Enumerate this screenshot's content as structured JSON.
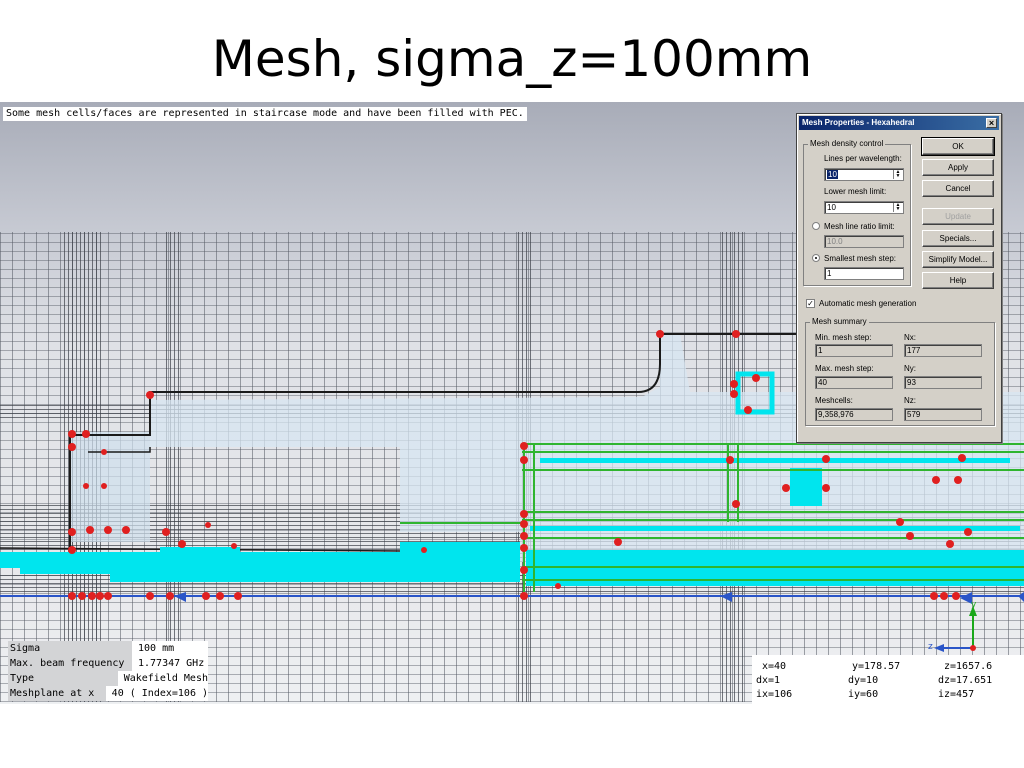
{
  "slide": {
    "title": "Mesh, sigma_z=100mm"
  },
  "viewport": {
    "status_message": "Some mesh cells/faces are represented in staircase mode and have been filled with PEC.",
    "axis_labels": {
      "y": "y",
      "z": "z"
    }
  },
  "legend": [
    {
      "key": "Sigma",
      "value": "100 mm"
    },
    {
      "key": "Max. beam frequency",
      "value": "1.77347 GHz"
    },
    {
      "key": "Type",
      "value": "Wakefield Mesh"
    },
    {
      "key": "Meshplane at x",
      "value": "40 ( Index=106 )"
    }
  ],
  "coordinates": {
    "x": "x=40",
    "y": "y=178.57",
    "z": "z=1657.6",
    "dx": "dx=1",
    "dy": "dy=10",
    "dz": "dz=17.651",
    "ix": "ix=106",
    "iy": "iy=60",
    "iz": "iz=457"
  },
  "dialog": {
    "title": "Mesh Properties - Hexahedral",
    "close_glyph": "×",
    "density_group": "Mesh density control",
    "lines_per_wavelength_label": "Lines per wavelength:",
    "lines_per_wavelength_value": "10",
    "lower_mesh_limit_label": "Lower mesh limit:",
    "lower_mesh_limit_value": "10",
    "ratio_limit_label": "Mesh line ratio limit:",
    "ratio_limit_value": "10.0",
    "smallest_step_label": "Smallest mesh step:",
    "smallest_step_value": "1",
    "auto_mesh_label": "Automatic mesh generation",
    "auto_mesh_checked": true,
    "selected_option": "smallest_mesh_step",
    "buttons": {
      "ok": "OK",
      "apply": "Apply",
      "cancel": "Cancel",
      "update": "Update",
      "specials": "Specials...",
      "simplify": "Simplify Model...",
      "help": "Help"
    },
    "summary_group": "Mesh summary",
    "summary": {
      "min_step_label": "Min. mesh step:",
      "min_step_value": "1",
      "nx_label": "Nx:",
      "nx_value": "177",
      "max_step_label": "Max. mesh step:",
      "max_step_value": "40",
      "ny_label": "Ny:",
      "ny_value": "93",
      "meshcells_label": "Meshcells:",
      "meshcells_value": "9,358,976",
      "nz_label": "Nz:",
      "nz_value": "579"
    }
  },
  "colors": {
    "pec_fill": "#00e5ee",
    "mesh_node": "#e02020",
    "port_green": "#2fb52f",
    "geometry_outline": "#1a1a1a",
    "dialog_title": "#0a246a"
  }
}
